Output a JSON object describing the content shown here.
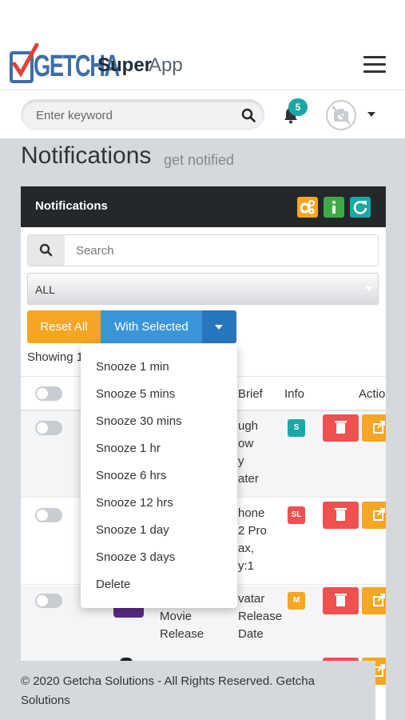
{
  "header": {
    "logo_text": "GETCHA",
    "app_super": "Super",
    "app_name": "App",
    "search_placeholder": "Enter keyword",
    "notification_count": "5"
  },
  "page": {
    "title": "Notifications",
    "subtitle": "get notified"
  },
  "card": {
    "title": "Notifications",
    "search_placeholder": "Search",
    "filter_value": "ALL",
    "reset_label": "Reset All",
    "with_selected_label": "With Selected",
    "showing_text": "Showing 1"
  },
  "table": {
    "columns": [
      "Brief",
      "Info",
      "Action"
    ],
    "rows": [
      {
        "brief": [
          "ugh",
          "ow",
          "y",
          "ater"
        ],
        "badge": "S",
        "badge_color": "#1aa8a6"
      },
      {
        "brief": [
          "hone",
          "2 Pro",
          "ax,",
          "y:1"
        ],
        "badge": "SL",
        "badge_color": "#f05050"
      },
      {
        "title": [
          "Movie",
          "Release"
        ],
        "brief": [
          "vatar",
          "Release",
          "Date"
        ],
        "badge": "M",
        "badge_color": "#f5a623"
      }
    ]
  },
  "dropdown": {
    "items": [
      "Snooze 1 min",
      "Snooze 5 mins",
      "Snooze 30 mins",
      "Snooze 1 hr",
      "Snooze 6 hrs",
      "Snooze 12 hrs",
      "Snooze 1 day",
      "Snooze 3 days",
      "Delete"
    ]
  },
  "footer": {
    "text": "© 2020 Getcha Solutions - All Rights Reserved. Getcha Solutions"
  },
  "colors": {
    "orange": "#f5a623",
    "blue": "#3b96d9",
    "teal": "#1aa8a6",
    "green": "#3eaa46",
    "red": "#f05050",
    "dark": "#25282b"
  }
}
